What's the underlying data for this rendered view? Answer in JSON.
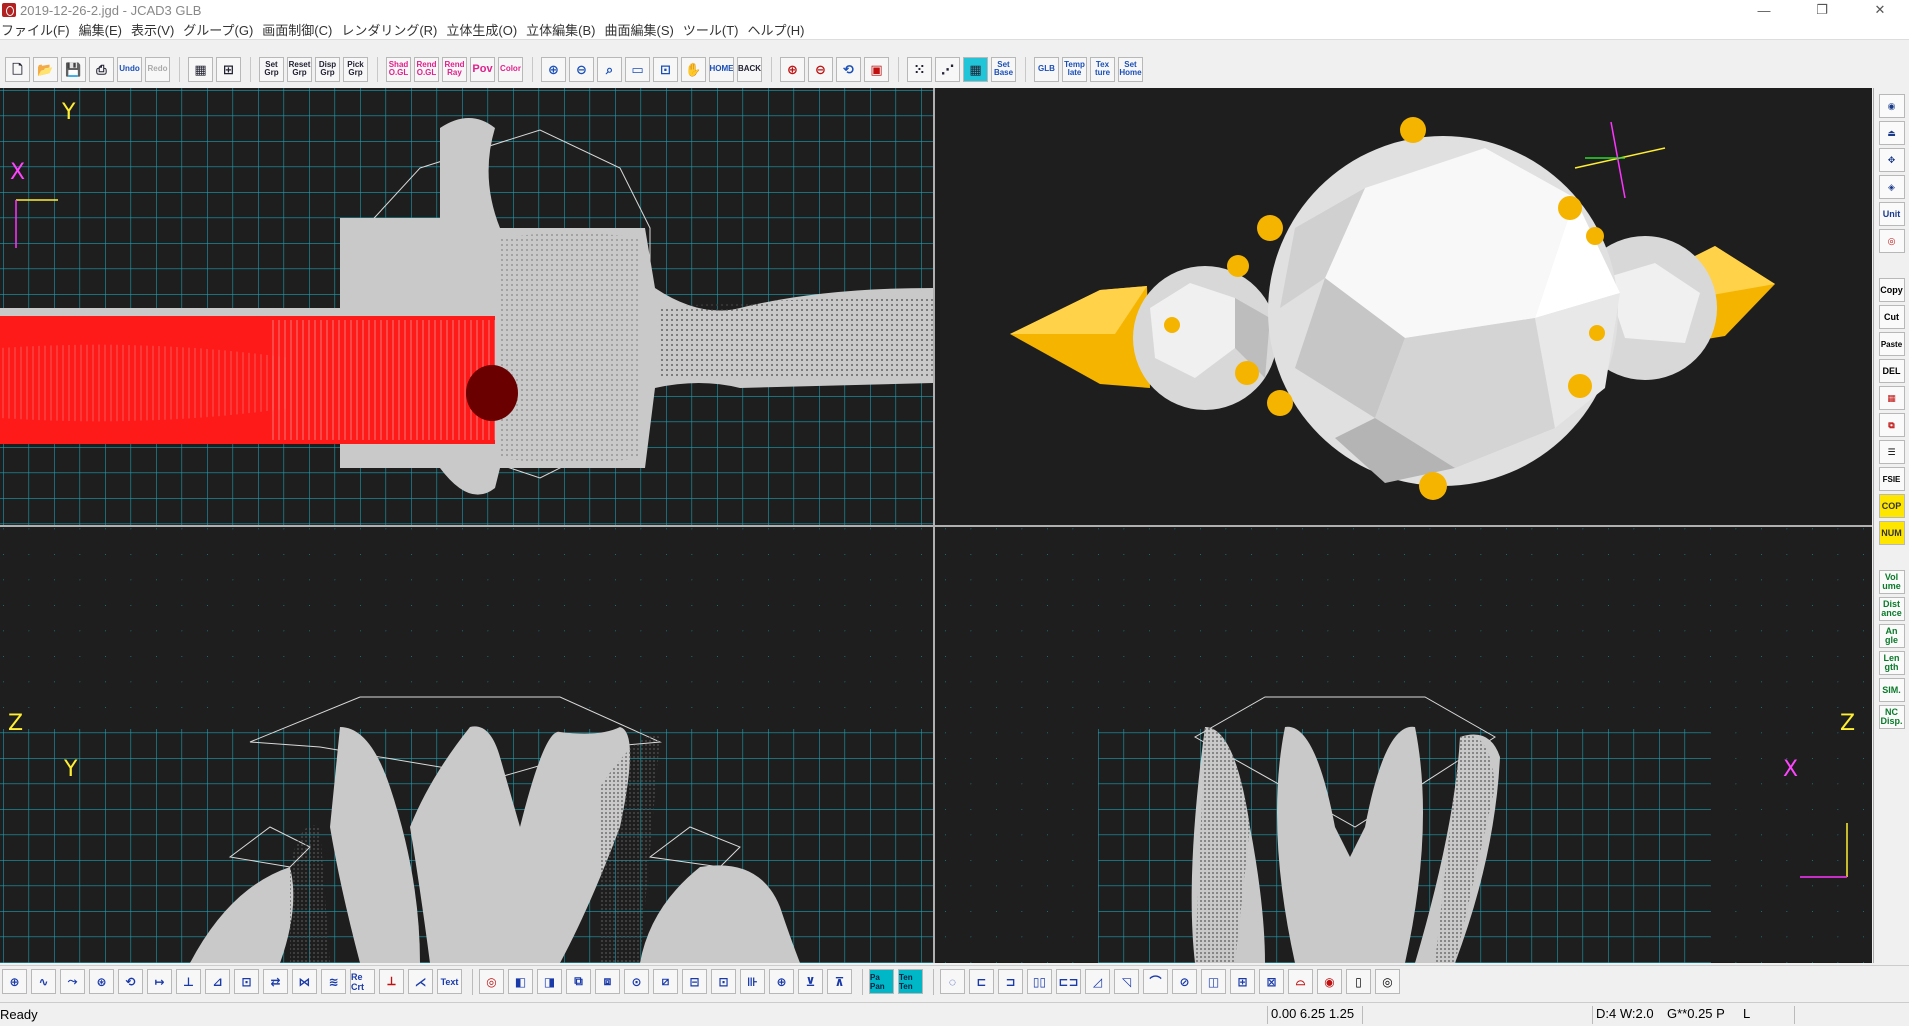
{
  "window": {
    "title": "2019-12-26-2.jgd - JCAD3 GLB",
    "controls": [
      "—",
      "❐",
      "✕"
    ]
  },
  "menu": [
    {
      "label": "ファイル(F)"
    },
    {
      "label": "編集(E)"
    },
    {
      "label": "表示(V)"
    },
    {
      "label": "グループ(G)"
    },
    {
      "label": "画面制御(C)"
    },
    {
      "label": "レンダリング(R)"
    },
    {
      "label": "立体生成(O)"
    },
    {
      "label": "立体編集(B)"
    },
    {
      "label": "曲面編集(S)"
    },
    {
      "label": "ツール(T)"
    },
    {
      "label": "ヘルプ(H)"
    }
  ],
  "toolbar": {
    "file": [
      {
        "label": "",
        "icon": "new-file-icon"
      },
      {
        "label": "",
        "icon": "open-folder-icon"
      },
      {
        "label": "",
        "icon": "save-icon"
      },
      {
        "label": "",
        "icon": "print-icon"
      },
      {
        "label": "Undo",
        "icon": "undo-icon"
      },
      {
        "label": "Redo",
        "icon": "redo-icon"
      }
    ],
    "layout": [
      {
        "label": "",
        "icon": "grid-layout-icon"
      },
      {
        "label": "",
        "icon": "quad-layout-icon"
      }
    ],
    "group": [
      {
        "label": "Set Grp"
      },
      {
        "label": "Reset Grp"
      },
      {
        "label": "Disp Grp"
      },
      {
        "label": "Pick Grp"
      }
    ],
    "render": [
      {
        "label": "Shad O.GL"
      },
      {
        "label": "Rend O.GL"
      },
      {
        "label": "Rend Ray"
      },
      {
        "label": "Pov"
      },
      {
        "label": "Color"
      }
    ],
    "view": [
      {
        "label": "",
        "icon": "zoom-in-icon"
      },
      {
        "label": "",
        "icon": "zoom-out-icon"
      },
      {
        "label": "",
        "icon": "zoom-window-icon"
      },
      {
        "label": "",
        "icon": "zoom-fit-icon"
      },
      {
        "label": "",
        "icon": "zoom-all-icon"
      },
      {
        "label": "",
        "icon": "pan-hand-icon"
      },
      {
        "label": "HOME"
      },
      {
        "label": "BACK"
      }
    ],
    "view2": [
      {
        "label": "",
        "icon": "zoom-red-plus-icon"
      },
      {
        "label": "",
        "icon": "zoom-red-minus-icon"
      },
      {
        "label": "",
        "icon": "zoom-3d-icon"
      },
      {
        "label": "",
        "icon": "frame-icon"
      }
    ],
    "grid": [
      {
        "label": "",
        "icon": "grid-dots-icon"
      },
      {
        "label": "",
        "icon": "grid-snap-icon"
      },
      {
        "label": "",
        "icon": "grid-color-icon"
      },
      {
        "label": "Set Base"
      }
    ],
    "misc": [
      {
        "label": "GLB"
      },
      {
        "label": "Temp late"
      },
      {
        "label": "Tex ture"
      },
      {
        "label": "Set Home"
      }
    ]
  },
  "viewports": {
    "top": {
      "axis_up": "Y",
      "axis_right": "X"
    },
    "front": {
      "axis_up": "Z",
      "axis_right": "Y"
    },
    "side": {
      "axis_up": "Z",
      "axis_right": "X"
    }
  },
  "right_panel": {
    "tools_a": [
      {
        "label": "",
        "icon": "ring-tool-icon"
      },
      {
        "label": "",
        "icon": "bezel-tool-icon"
      },
      {
        "label": "",
        "icon": "move-tool-icon"
      },
      {
        "label": "",
        "icon": "snap-tool-icon"
      },
      {
        "label": "Unit"
      },
      {
        "label": "",
        "icon": "circle-tool-icon"
      }
    ],
    "tools_b": [
      {
        "label": "Copy"
      },
      {
        "label": "Cut"
      },
      {
        "label": "Paste"
      },
      {
        "label": "DEL"
      },
      {
        "label": "",
        "icon": "grid-red-icon"
      },
      {
        "label": "",
        "icon": "layer-icon"
      },
      {
        "label": "",
        "icon": "tree-icon"
      },
      {
        "label": "FSIE"
      },
      {
        "label": "COP",
        "highlight": true
      },
      {
        "label": "NUM",
        "highlight": true
      }
    ],
    "tools_c": [
      {
        "label": "Vol ume"
      },
      {
        "label": "Dist ance"
      },
      {
        "label": "An gle"
      },
      {
        "label": "Len gth"
      },
      {
        "label": "SIM."
      },
      {
        "label": "NC Disp."
      }
    ]
  },
  "bottom_toolbar": {
    "create": [
      "⊕",
      "∿",
      "⤳",
      "⊛",
      "⟲",
      "↦",
      "⊥",
      "⊿",
      "⊡",
      "⇄",
      "⋈",
      "≋",
      "Re Crt",
      "⟂",
      "⋌",
      "Text"
    ],
    "modify": [
      "◎",
      "◧",
      "◨",
      "⧉",
      "⧈",
      "⊙",
      "⧄",
      "⊟",
      "⊡",
      "⊪",
      "⊕",
      "⊻",
      "⊼"
    ],
    "pan": [
      "Pa Pan",
      "Ten Ten"
    ],
    "edit": [
      "◌",
      "⊏",
      "⊐",
      "▯▯",
      "⊏⊐",
      "◿",
      "◹",
      "⌒",
      "⊘",
      "◫",
      "⊞",
      "⊠",
      "⌓",
      "◉",
      "▯",
      "◎"
    ]
  },
  "status": {
    "ready": "Ready",
    "coords": "0.00 6.25 1.25",
    "grid": "D:4 W:2.0",
    "gparam": "G**0.25 P",
    "mode": "L"
  },
  "colors": {
    "grid_line": "#1c9db0",
    "wire": "#d9d9d9",
    "shape": "#c9c9c9",
    "selected": "#ff1a1a",
    "gold": "#f5b400",
    "viewport_bg": "#1e1e1e"
  }
}
